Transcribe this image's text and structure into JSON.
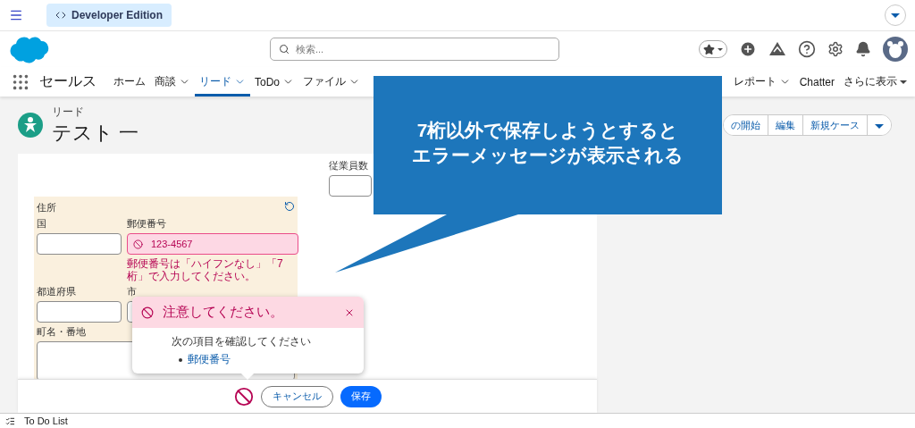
{
  "top_bar": {
    "edition": "Developer Edition"
  },
  "header": {
    "search": {
      "placeholder": "検索..."
    }
  },
  "nav": {
    "app_name": "セールス",
    "tabs": [
      {
        "label": "ホーム",
        "dropdown": false,
        "selected": false
      },
      {
        "label": "商談",
        "dropdown": true,
        "selected": false
      },
      {
        "label": "リード",
        "dropdown": true,
        "selected": true
      },
      {
        "label": "ToDo",
        "dropdown": true,
        "selected": false
      },
      {
        "label": "ファイル",
        "dropdown": true,
        "selected": false
      }
    ],
    "right_tabs": [
      {
        "label": "レポート",
        "dropdown": true,
        "selected": false
      },
      {
        "label": "Chatter",
        "dropdown": false,
        "selected": false
      }
    ],
    "more": "さらに表示"
  },
  "record": {
    "object": "リード",
    "name": "テスト 一",
    "actions": [
      "の開始",
      "編集",
      "新規ケース"
    ]
  },
  "form": {
    "employees_label": "従業員数",
    "address": {
      "title": "住所",
      "country_label": "国",
      "postal_label": "郵便番号",
      "postal_value": "123-4567",
      "postal_invalid": true,
      "postal_error": "郵便番号は「ハイフンなし」「7桁」で入力してください。",
      "state_label": "都道府県",
      "city_label": "市",
      "street_label": "町名・番地"
    }
  },
  "footer": {
    "cancel": "キャンセル",
    "save": "保存"
  },
  "popover": {
    "title": "注意してください。",
    "message": "次の項目を確認してください",
    "fields": [
      "郵便番号"
    ]
  },
  "utility_bar": {
    "label": "To Do List"
  },
  "callout": {
    "lines": [
      "7桁以外で保存しようとすると",
      "エラーメッセージが表示される"
    ]
  }
}
